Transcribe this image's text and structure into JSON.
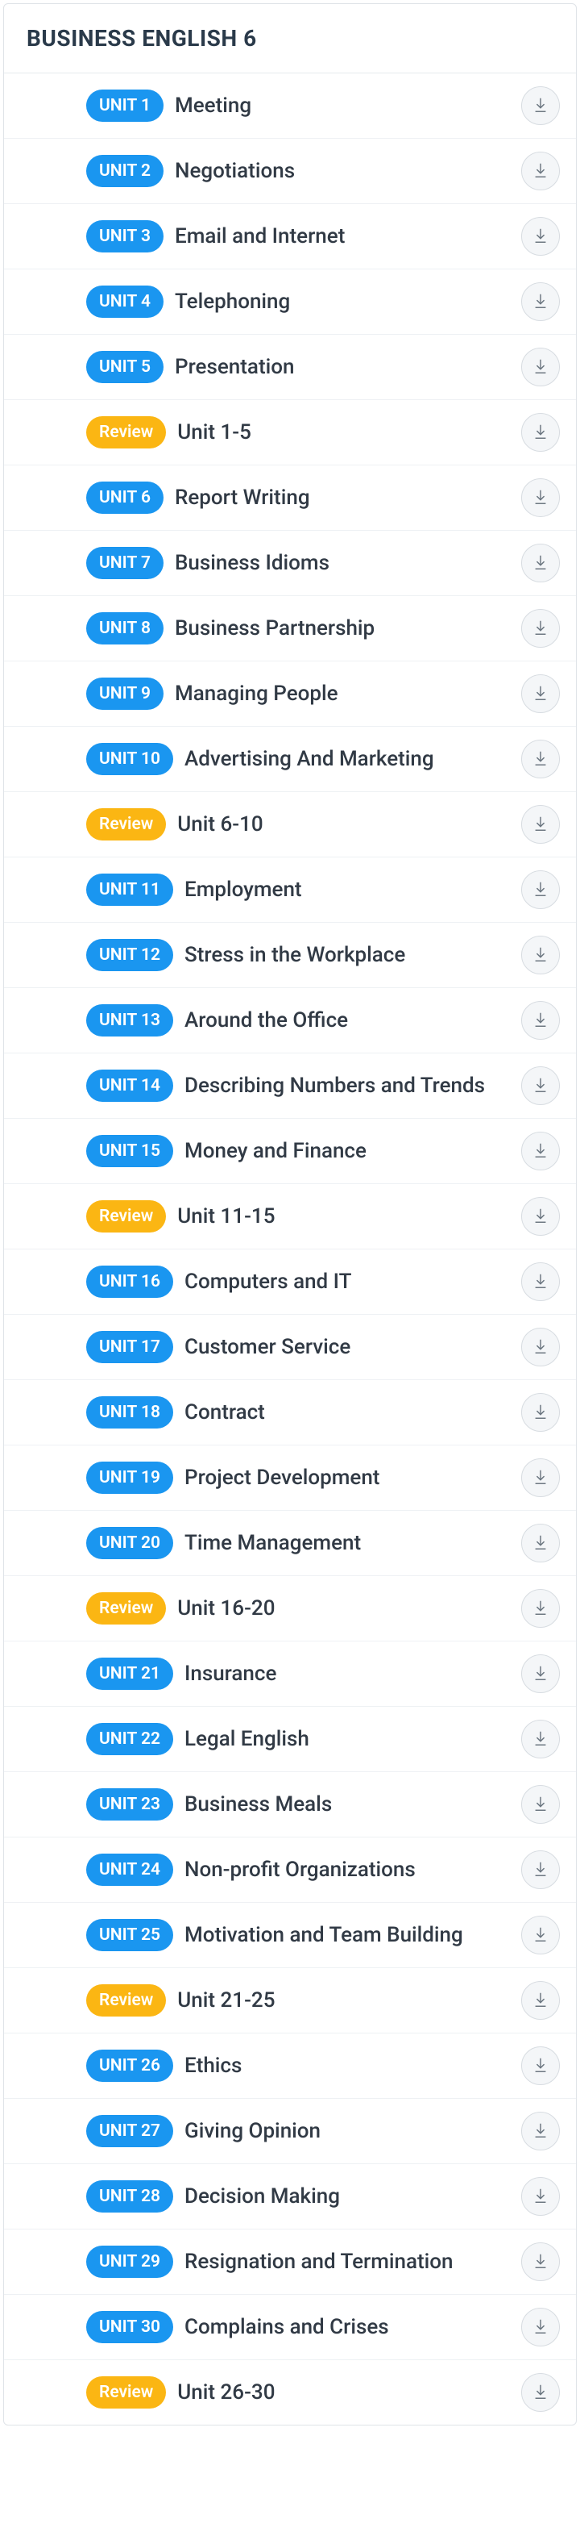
{
  "header": {
    "title": "BUSINESS ENGLISH 6"
  },
  "rows": [
    {
      "type": "unit",
      "badge": "UNIT 1",
      "title": "Meeting"
    },
    {
      "type": "unit",
      "badge": "UNIT 2",
      "title": "Negotiations"
    },
    {
      "type": "unit",
      "badge": "UNIT 3",
      "title": "Email and Internet"
    },
    {
      "type": "unit",
      "badge": "UNIT 4",
      "title": "Telephoning"
    },
    {
      "type": "unit",
      "badge": "UNIT 5",
      "title": "Presentation"
    },
    {
      "type": "review",
      "badge": "Review",
      "title": "Unit 1-5"
    },
    {
      "type": "unit",
      "badge": "UNIT 6",
      "title": "Report Writing"
    },
    {
      "type": "unit",
      "badge": "UNIT 7",
      "title": "Business Idioms"
    },
    {
      "type": "unit",
      "badge": "UNIT 8",
      "title": "Business Partnership"
    },
    {
      "type": "unit",
      "badge": "UNIT 9",
      "title": "Managing People"
    },
    {
      "type": "unit",
      "badge": "UNIT 10",
      "title": "Advertising And Marketing"
    },
    {
      "type": "review",
      "badge": "Review",
      "title": "Unit 6-10"
    },
    {
      "type": "unit",
      "badge": "UNIT 11",
      "title": "Employment"
    },
    {
      "type": "unit",
      "badge": "UNIT 12",
      "title": "Stress in the Workplace"
    },
    {
      "type": "unit",
      "badge": "UNIT 13",
      "title": "Around the Office"
    },
    {
      "type": "unit",
      "badge": "UNIT 14",
      "title": "Describing Numbers and Trends"
    },
    {
      "type": "unit",
      "badge": "UNIT 15",
      "title": "Money and Finance"
    },
    {
      "type": "review",
      "badge": "Review",
      "title": "Unit 11-15"
    },
    {
      "type": "unit",
      "badge": "UNIT 16",
      "title": "Computers and IT"
    },
    {
      "type": "unit",
      "badge": "UNIT 17",
      "title": "Customer Service"
    },
    {
      "type": "unit",
      "badge": "UNIT 18",
      "title": "Contract"
    },
    {
      "type": "unit",
      "badge": "UNIT 19",
      "title": "Project Development"
    },
    {
      "type": "unit",
      "badge": "UNIT 20",
      "title": "Time Management"
    },
    {
      "type": "review",
      "badge": "Review",
      "title": "Unit 16-20"
    },
    {
      "type": "unit",
      "badge": "UNIT 21",
      "title": "Insurance"
    },
    {
      "type": "unit",
      "badge": "UNIT 22",
      "title": "Legal English"
    },
    {
      "type": "unit",
      "badge": "UNIT 23",
      "title": "Business Meals"
    },
    {
      "type": "unit",
      "badge": "UNIT 24",
      "title": "Non-profit Organizations"
    },
    {
      "type": "unit",
      "badge": "UNIT 25",
      "title": "Motivation and Team Building"
    },
    {
      "type": "review",
      "badge": "Review",
      "title": "Unit 21-25"
    },
    {
      "type": "unit",
      "badge": "UNIT 26",
      "title": "Ethics"
    },
    {
      "type": "unit",
      "badge": "UNIT 27",
      "title": "Giving Opinion"
    },
    {
      "type": "unit",
      "badge": "UNIT 28",
      "title": "Decision Making"
    },
    {
      "type": "unit",
      "badge": "UNIT 29",
      "title": "Resignation and Termination"
    },
    {
      "type": "unit",
      "badge": "UNIT 30",
      "title": "Complains and Crises"
    },
    {
      "type": "review",
      "badge": "Review",
      "title": "Unit 26-30"
    }
  ]
}
